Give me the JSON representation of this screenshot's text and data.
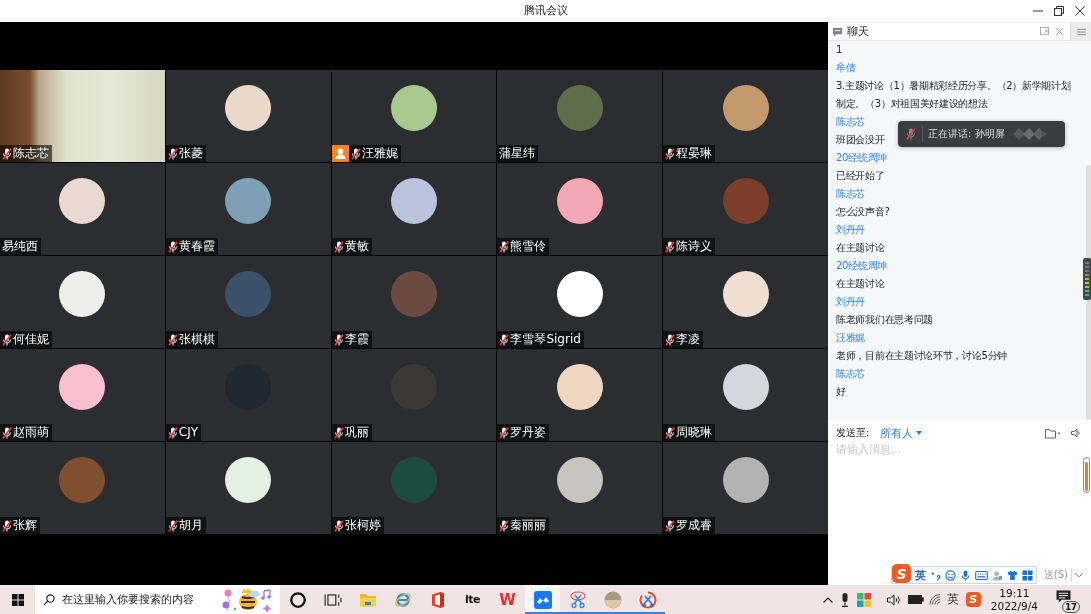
{
  "window": {
    "title": "腾讯会议"
  },
  "participants": [
    {
      "name": "陈志芯",
      "kind": "video",
      "muted": true,
      "badge": false
    },
    {
      "name": "张菱",
      "kind": "avatar",
      "muted": true,
      "badge": false,
      "color": "#e9d9cb"
    },
    {
      "name": "汪雅娓",
      "kind": "avatar",
      "muted": true,
      "badge": true,
      "color": "#a9c98f"
    },
    {
      "name": "蒲星纬",
      "kind": "avatar",
      "muted": false,
      "badge": false,
      "color": "#5f6f4e"
    },
    {
      "name": "程晏琳",
      "kind": "avatar",
      "muted": true,
      "badge": false,
      "color": "#c49a6c"
    },
    {
      "name": "易纯西",
      "kind": "avatar",
      "muted": false,
      "badge": false,
      "color": "#ead9d0"
    },
    {
      "name": "黄春霞",
      "kind": "avatar",
      "muted": true,
      "badge": false,
      "color": "#7f9fb5"
    },
    {
      "name": "黄敏",
      "kind": "avatar",
      "muted": true,
      "badge": false,
      "color": "#b9c3de"
    },
    {
      "name": "熊雪伶",
      "kind": "avatar",
      "muted": true,
      "badge": false,
      "color": "#f2a7b6"
    },
    {
      "name": "陈诗义",
      "kind": "avatar",
      "muted": true,
      "badge": false,
      "color": "#7a3e2a"
    },
    {
      "name": "何佳妮",
      "kind": "avatar",
      "muted": true,
      "badge": false,
      "color": "#eeeeea"
    },
    {
      "name": "张棋棋",
      "kind": "avatar",
      "muted": true,
      "badge": false,
      "color": "#3a5169"
    },
    {
      "name": "李霞",
      "kind": "avatar",
      "muted": true,
      "badge": false,
      "color": "#6b4a41"
    },
    {
      "name": "李雪琴Sigrid",
      "kind": "avatar",
      "muted": true,
      "badge": false,
      "color": "#ffffff"
    },
    {
      "name": "李凌",
      "kind": "avatar",
      "muted": true,
      "badge": false,
      "color": "#efdfd1"
    },
    {
      "name": "赵雨萌",
      "kind": "avatar",
      "muted": true,
      "badge": false,
      "color": "#f7bfd0"
    },
    {
      "name": "CJY",
      "kind": "avatar",
      "muted": true,
      "badge": false,
      "color": "#1f2730"
    },
    {
      "name": "巩丽",
      "kind": "avatar",
      "muted": true,
      "badge": false,
      "color": "#3b3838"
    },
    {
      "name": "罗丹姿",
      "kind": "avatar",
      "muted": true,
      "badge": false,
      "color": "#efd7c1"
    },
    {
      "name": "周晓琳",
      "kind": "avatar",
      "muted": true,
      "badge": false,
      "color": "#d5d6de"
    },
    {
      "name": "张辉",
      "kind": "avatar",
      "muted": true,
      "badge": false,
      "color": "#7f4f2f"
    },
    {
      "name": "胡月",
      "kind": "avatar",
      "muted": true,
      "badge": false,
      "color": "#e3f1e2"
    },
    {
      "name": "张柯婷",
      "kind": "avatar",
      "muted": true,
      "badge": false,
      "color": "#1c4b41"
    },
    {
      "name": "秦丽丽",
      "kind": "avatar",
      "muted": true,
      "badge": false,
      "color": "#c6c6be"
    },
    {
      "name": "罗成睿",
      "kind": "avatar",
      "muted": true,
      "badge": false,
      "color": "#b3b3b3"
    }
  ],
  "chat": {
    "title": "聊天",
    "messages": [
      {
        "text": "1"
      },
      {
        "sender": "牟倩",
        "text": "3.主题讨论（1）暑期精彩经历分享。（2）新学期计划制定。（3）对祖国美好建设的想法"
      },
      {
        "sender": "陈志芯",
        "text": "班团会没开"
      },
      {
        "sender": "20经统周坤",
        "text": "已经开始了"
      },
      {
        "sender": "陈志芯",
        "text": "怎么没声音?"
      },
      {
        "sender": "刘丹丹",
        "text": "在主题讨论"
      },
      {
        "sender": "20经统周坤",
        "text": "在主题讨论"
      },
      {
        "sender": "刘丹丹",
        "text": "陈老师我们在思考问题"
      },
      {
        "sender": "汪雅娓",
        "text": "老师，目前在主题讨论环节，讨论5分钟"
      },
      {
        "sender": "陈志芯",
        "text": "好"
      }
    ],
    "send_to_label": "发送至:",
    "recipient": "所有人",
    "placeholder": "请输入消息...",
    "send_button": "送(S)"
  },
  "speaking_toast": {
    "text": "正在讲话: 孙明屏"
  },
  "ime_toolbar": {
    "logo": "S",
    "mode": "英"
  },
  "taskbar": {
    "search_placeholder": "在这里输入你要搜索的内容",
    "apps": [
      {
        "kind": "cortana",
        "running": false,
        "selected": false
      },
      {
        "kind": "task-view",
        "running": false,
        "selected": false
      },
      {
        "kind": "explorer",
        "running": false,
        "selected": false
      },
      {
        "kind": "browser",
        "running": false,
        "selected": false
      },
      {
        "kind": "office",
        "running": false,
        "selected": false
      },
      {
        "kind": "lte",
        "glyph": "lte",
        "running": false,
        "selected": false
      },
      {
        "kind": "wps",
        "glyph": "W",
        "running": false,
        "selected": false
      },
      {
        "kind": "meeting",
        "running": true,
        "selected": true
      },
      {
        "kind": "snip",
        "running": true,
        "selected": false
      },
      {
        "kind": "photo",
        "running": true,
        "selected": false
      },
      {
        "kind": "paint-snip",
        "running": true,
        "selected": false
      }
    ],
    "ime_indicator": "英",
    "ime_logo": "S",
    "time": "19:11",
    "date": "2022/9/4",
    "notifications": "17"
  }
}
